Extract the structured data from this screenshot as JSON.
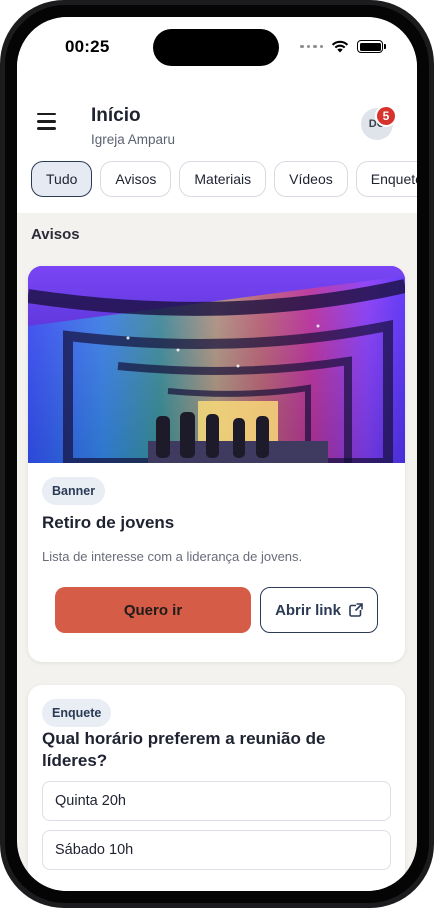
{
  "status": {
    "time": "00:25"
  },
  "header": {
    "title": "Início",
    "subtitle": "Igreja Amparu",
    "avatar_initials": "DO",
    "notification_count": "5",
    "menu_icon": "hamburger-menu-icon"
  },
  "filters": [
    {
      "label": "Tudo",
      "active": true
    },
    {
      "label": "Avisos",
      "active": false
    },
    {
      "label": "Materiais",
      "active": false
    },
    {
      "label": "Vídeos",
      "active": false
    },
    {
      "label": "Enquete",
      "active": false
    }
  ],
  "section": {
    "title": "Avisos"
  },
  "announcement": {
    "badge": "Banner",
    "title": "Retiro de jovens",
    "description": "Lista de interesse com a liderança de jovens.",
    "primary_button": "Quero ir",
    "secondary_button": "Abrir link",
    "secondary_icon": "external-link-icon"
  },
  "poll": {
    "badge": "Enquete",
    "question": "Qual horário preferem a reunião de líderes?",
    "options": [
      "Quinta 20h",
      "Sábado 10h"
    ]
  },
  "colors": {
    "primary_button": "#d55c46",
    "accent_navy": "#2b3a55",
    "notification_red": "#d6332f",
    "background": "#f4f2ee"
  }
}
